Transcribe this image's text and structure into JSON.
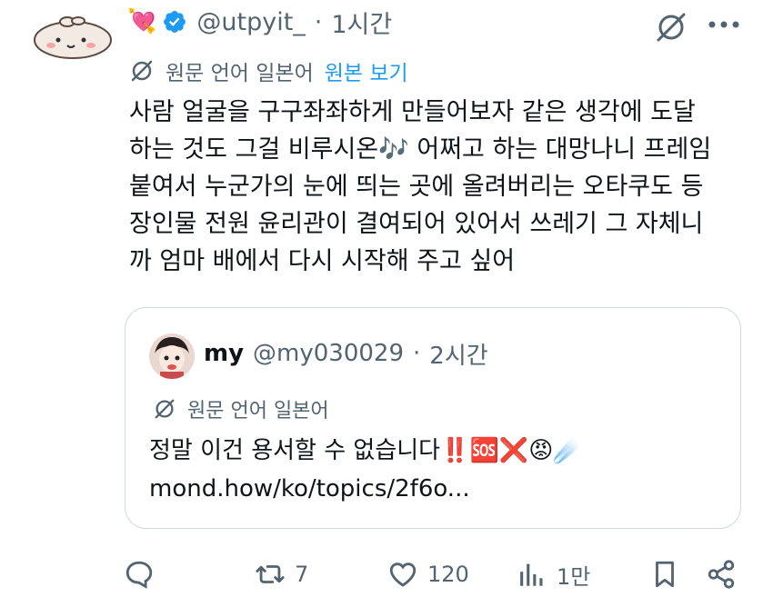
{
  "post": {
    "emoji": "💘",
    "handle": "@utpyit_",
    "separator": "·",
    "time": "1시간",
    "translate_label": "원문 언어 일본어",
    "translate_link": "원본 보기",
    "text": "사람 얼굴을 구구좌좌하게 만들어보자 같은 생각에 도달\n하는 것도 그걸 비루시온🎶 어쩌고 하는 대망나니 프레임\n붙여서 누군가의 눈에 띄는 곳에 올려버리는 오타쿠도 등\n장인물 전원 윤리관이 결여되어 있어서 쓰레기 그 자체니\n까 엄마 배에서 다시 시작해 주고 싶어"
  },
  "quote": {
    "name": "my",
    "handle": "@my030029",
    "separator": "·",
    "time": "2시간",
    "translate_label": "원문 언어 일본어",
    "text": "정말 이건 용서할 수 없습니다‼️🆘❌😡☄️\nmond.how/ko/topics/2f6o..."
  },
  "actions": {
    "reply_count": "",
    "repost_count": "7",
    "like_count": "120",
    "views_count": "1만"
  },
  "colors": {
    "secondary_text": "#536471",
    "link": "#1d9bf0",
    "verified": "#1d9bf0",
    "border": "#cfd9de"
  },
  "icons": [
    "avatar",
    "heart-emoji",
    "verified-badge-icon",
    "grok-icon",
    "more-icon",
    "globe-icon",
    "reply-icon",
    "repost-icon",
    "like-icon",
    "views-icon",
    "bookmark-icon",
    "share-icon"
  ]
}
